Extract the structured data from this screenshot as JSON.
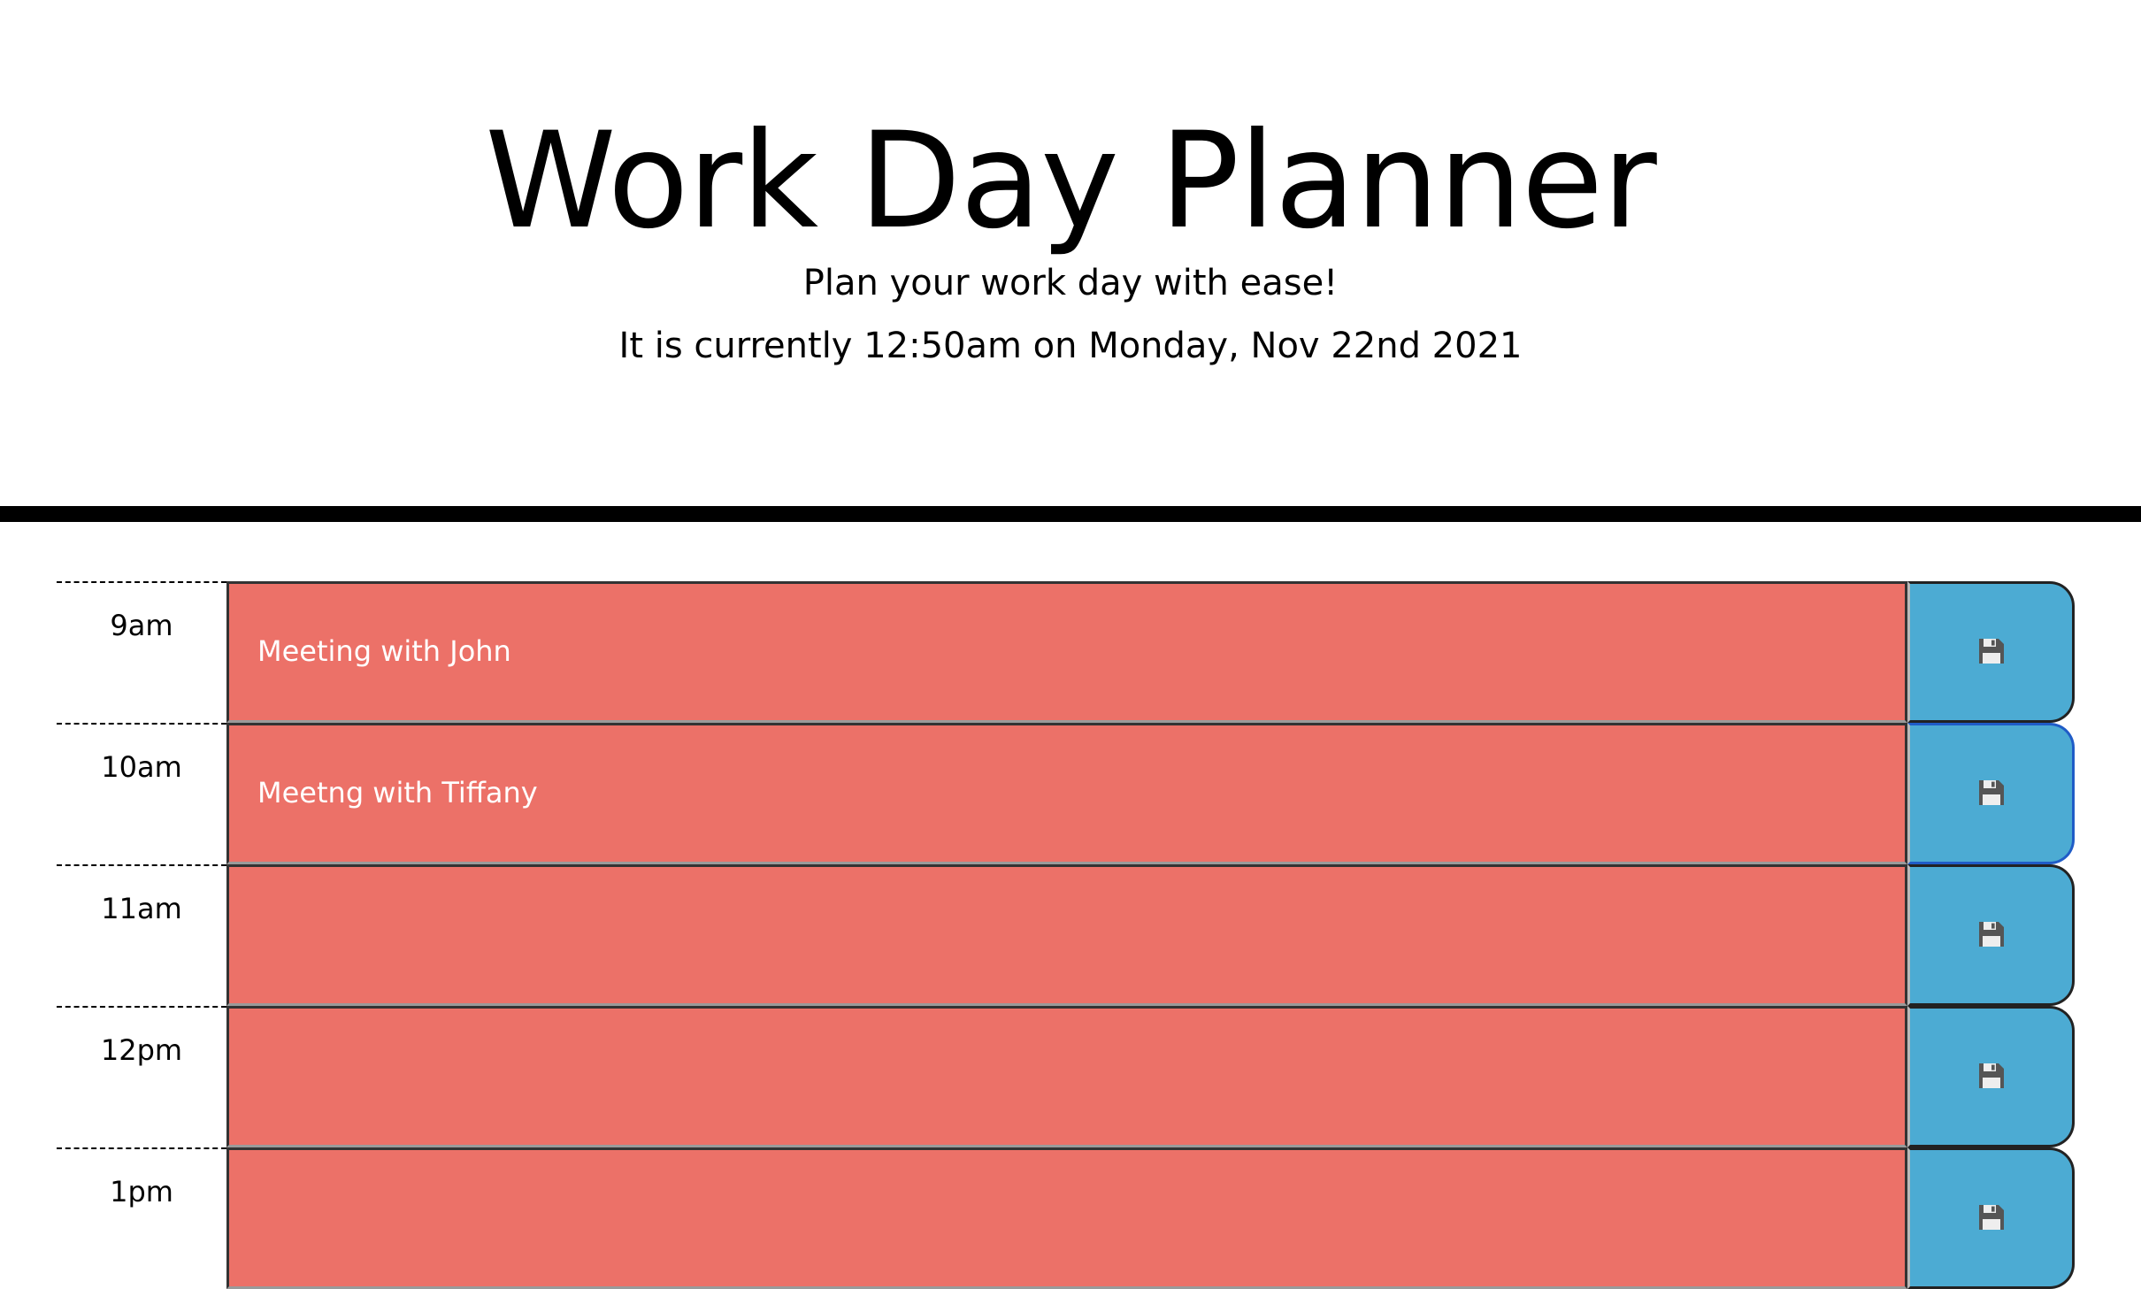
{
  "header": {
    "title": "Work Day Planner",
    "subtitle": "Plan your work day with ease!",
    "current_day": "It is currently 12:50am on Monday, Nov 22nd 2021"
  },
  "colors": {
    "past": "#ec7168",
    "save_button": "#4cabd3"
  },
  "time_blocks": [
    {
      "hour": "9am",
      "text": "Meeting with John",
      "save_icon": "floppy-disk-icon"
    },
    {
      "hour": "10am",
      "text": "Meetng with Tiffany",
      "save_icon": "floppy-disk-icon"
    },
    {
      "hour": "11am",
      "text": "",
      "save_icon": "floppy-disk-icon"
    },
    {
      "hour": "12pm",
      "text": "",
      "save_icon": "floppy-disk-icon"
    },
    {
      "hour": "1pm",
      "text": "",
      "save_icon": "floppy-disk-icon"
    }
  ]
}
